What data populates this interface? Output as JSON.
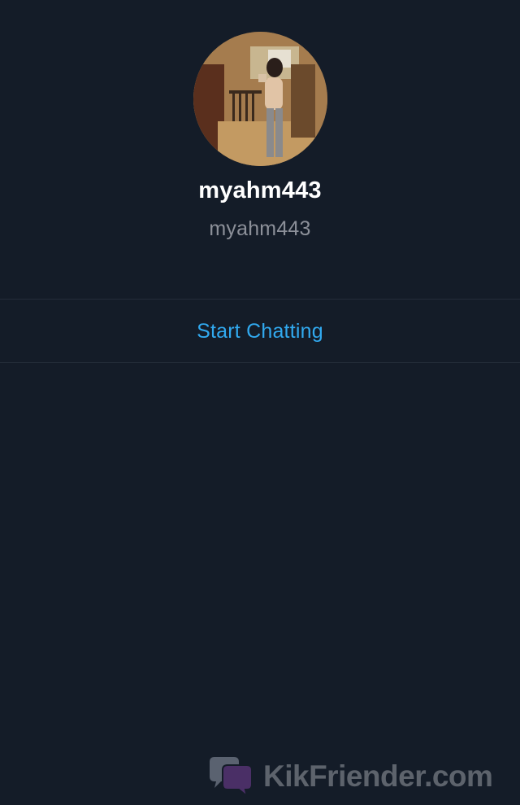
{
  "profile": {
    "display_name": "myahm443",
    "username": "myahm443"
  },
  "actions": {
    "start_chatting_label": "Start Chatting"
  },
  "watermark": {
    "text": "KikFriender.com",
    "icon": "chat-bubbles-logo"
  },
  "colors": {
    "background": "#141c28",
    "divider": "#242d3a",
    "display_name": "#ffffff",
    "username": "#8c9099",
    "accent_link": "#31a9ef"
  }
}
